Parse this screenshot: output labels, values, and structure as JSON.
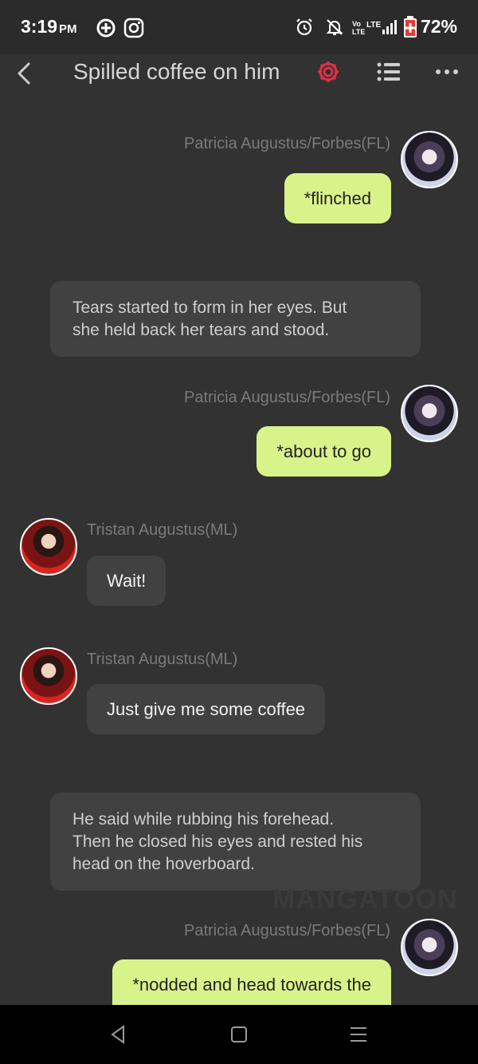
{
  "status_bar": {
    "time": "3:19",
    "ampm": "PM",
    "battery": "72%",
    "icons": [
      "gamepad-icon",
      "instagram-icon",
      "alarm-icon",
      "mute-icon",
      "volte-icon",
      "lte-icon",
      "signal-icon",
      "battery-icon"
    ]
  },
  "header": {
    "title": "Spilled coffee on him",
    "accent": "#e0304a"
  },
  "messages": [
    {
      "type": "me",
      "sender": "Patricia Augustus/Forbes(FL)",
      "text": "*flinched"
    },
    {
      "type": "narration",
      "line1": "Tears started to form in her eyes. But",
      "line2": "she held back her tears and stood."
    },
    {
      "type": "me",
      "sender": "Patricia Augustus/Forbes(FL)",
      "text": "*about to go"
    },
    {
      "type": "them",
      "sender": "Tristan Augustus(ML)",
      "text": "Wait!"
    },
    {
      "type": "them",
      "sender": "Tristan Augustus(ML)",
      "text": "Just give me some coffee"
    },
    {
      "type": "narration",
      "line1": "He said while rubbing his forehead.",
      "line2": "Then he closed his eyes and rested his",
      "line3": "head on the hoverboard."
    },
    {
      "type": "me",
      "sender": "Patricia Augustus/Forbes(FL)",
      "text": "*nodded and head towards the"
    }
  ],
  "watermark": "MANGATOON",
  "colors": {
    "my_bubble": "#d9f38b",
    "their_bubble": "#414141",
    "background": "#323232"
  }
}
